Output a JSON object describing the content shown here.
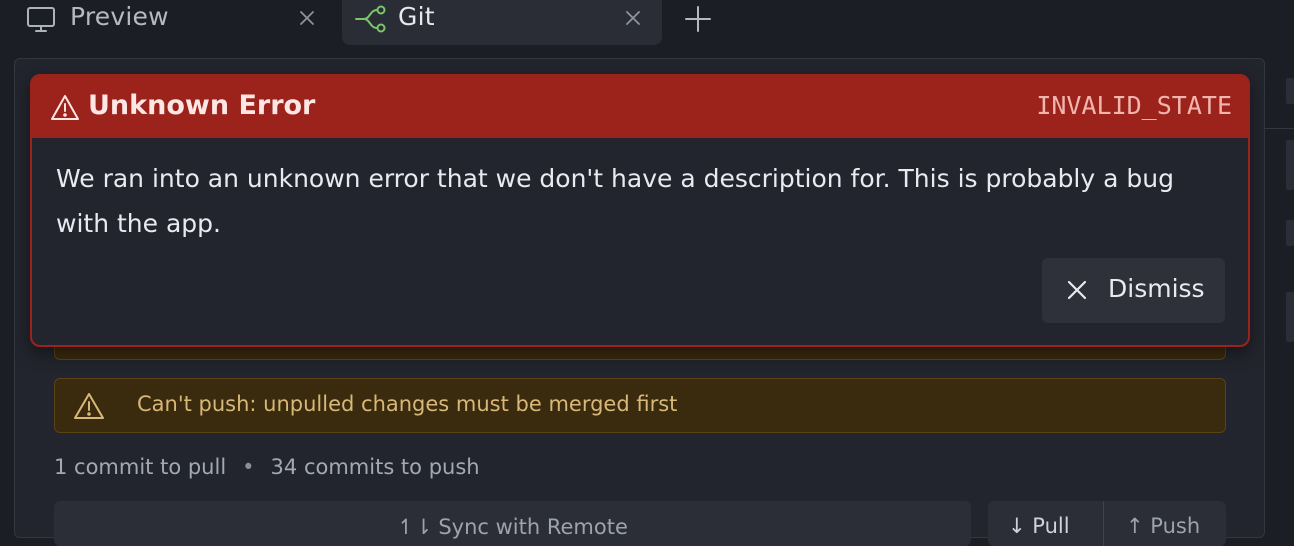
{
  "tabs": [
    {
      "label": "Preview",
      "icon": "monitor-icon"
    },
    {
      "label": "Git",
      "icon": "git-branch-icon",
      "active": true
    }
  ],
  "content": {
    "partial_banner_text": "",
    "warning_text": "Can't push: unpulled changes must be merged first",
    "status": {
      "pull_count": "1 commit to pull",
      "separator": "•",
      "push_count": "34 commits to push"
    },
    "actions": {
      "sync_label": "Sync with Remote",
      "pull_label": "Pull",
      "push_label": "Push"
    }
  },
  "error": {
    "title": "Unknown Error",
    "code": "INVALID_STATE",
    "message": "We ran into an unknown error that we don't have a description for. This is probably a bug with the app.",
    "dismiss_label": "Dismiss"
  },
  "colors": {
    "error_header": "#9c231b",
    "warning_bg": "#3a2a0e",
    "warning_text": "#d8b878",
    "git_icon": "#7cc46a"
  }
}
